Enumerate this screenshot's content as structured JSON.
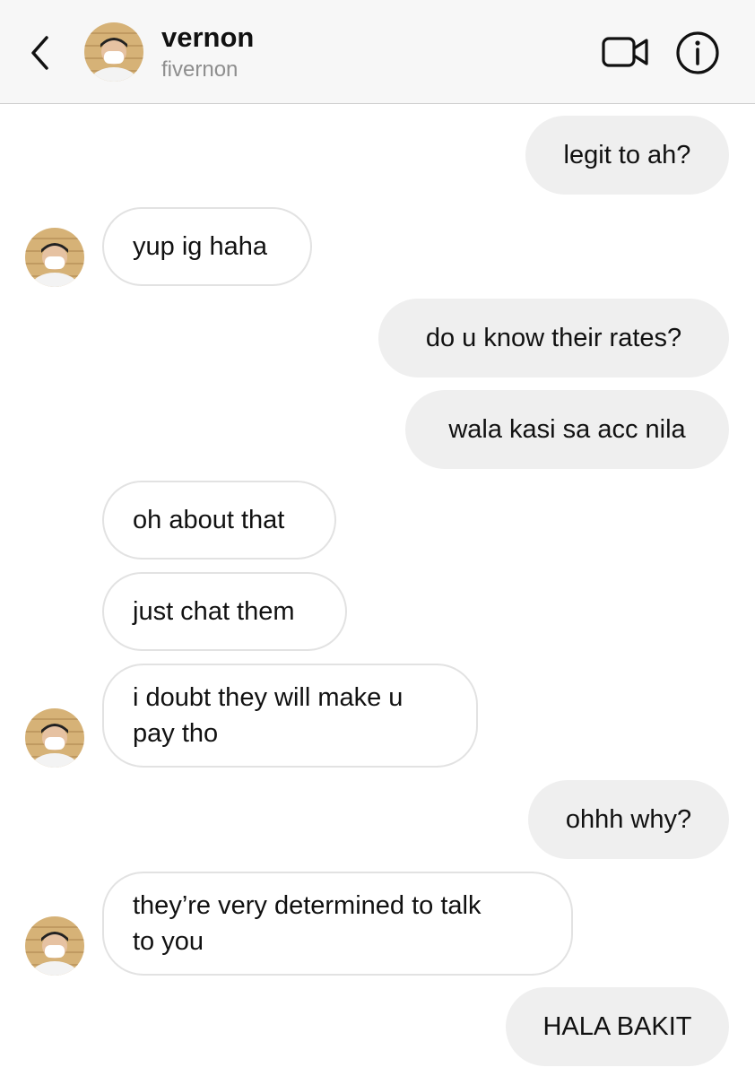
{
  "header": {
    "title": "vernon",
    "username": "fivernon",
    "icons": {
      "back": "chevron-left-icon",
      "video": "video-camera-icon",
      "info": "info-icon"
    }
  },
  "messages": [
    {
      "from": "me",
      "text": "legit to ah?"
    },
    {
      "from": "them",
      "text": "yup ig haha"
    },
    {
      "from": "me",
      "text": "do u know their rates?"
    },
    {
      "from": "me",
      "text": "wala kasi sa acc nila"
    },
    {
      "from": "them",
      "text": "oh about that"
    },
    {
      "from": "them",
      "text": "just chat them"
    },
    {
      "from": "them",
      "text": "i doubt they will make u\npay tho"
    },
    {
      "from": "me",
      "text": "ohhh why?"
    },
    {
      "from": "them",
      "text": "they’re very determined to talk\nto you"
    },
    {
      "from": "me",
      "text": "HALA BAKIT"
    }
  ],
  "colors": {
    "header_bg": "#f7f7f7",
    "sent_bubble": "#efefef",
    "received_border": "#e2e2e2",
    "subtitle": "#8e8e8e"
  }
}
